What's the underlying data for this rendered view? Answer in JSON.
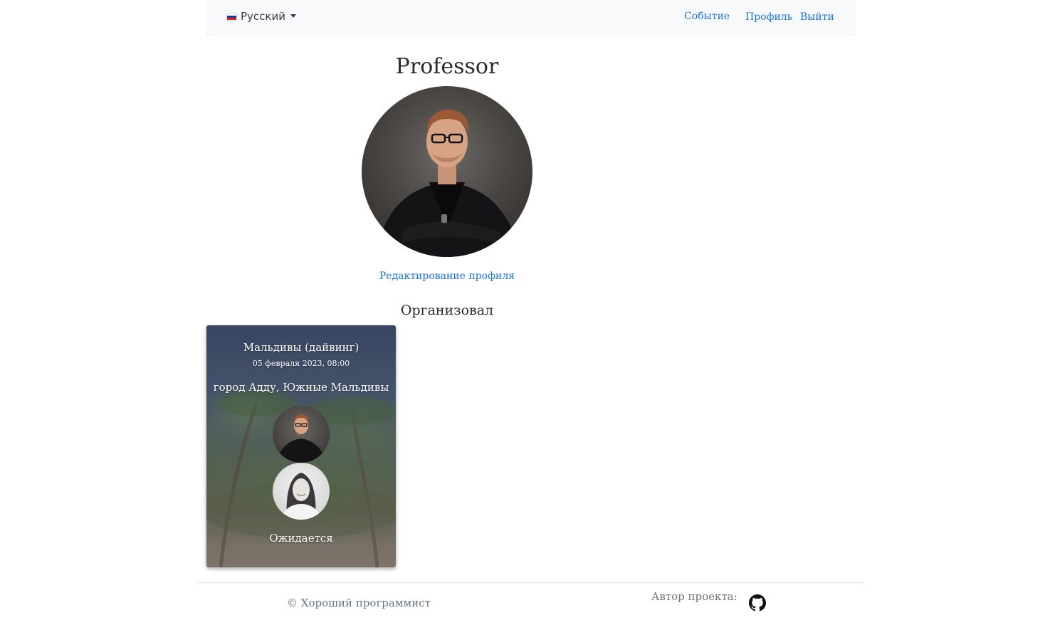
{
  "navbar": {
    "language": "Русский",
    "links": {
      "event": "Событие",
      "profile": "Профиль",
      "logout": "Выйти"
    }
  },
  "profile": {
    "username": "Professor",
    "edit_link": "Редактирование профиля",
    "organized_heading": "Организовал"
  },
  "event_card": {
    "title": "Мальдивы (дайвинг)",
    "datetime": "05 февраля 2023, 08:00",
    "location": "город Адду, Южные Мальдивы",
    "status": "Ожидается"
  },
  "footer": {
    "copyright": "© Хороший программист",
    "author_label": "Автор проекта:"
  },
  "colors": {
    "link": "#1a73d9",
    "navbar_bg": "#f8f9fa",
    "muted_text": "#6c757d"
  },
  "icons": [
    "russia-flag-icon",
    "caret-down-icon",
    "github-icon"
  ]
}
